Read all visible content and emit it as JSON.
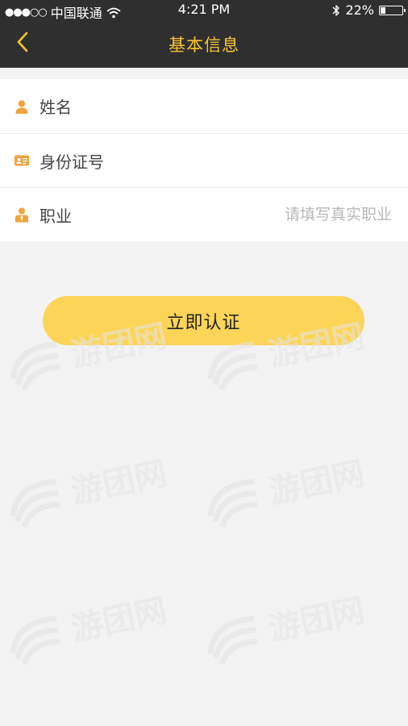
{
  "status_bar": {
    "signal": "●●●○○",
    "carrier": "中国联通",
    "time": "4:21 PM",
    "battery_text": "22%",
    "battery_level": 0.22
  },
  "nav": {
    "back_icon": "chevron-left-icon",
    "title": "基本信息",
    "accent_color": "#f7c431"
  },
  "form": {
    "rows": [
      {
        "icon": "person-icon",
        "label": "姓名",
        "placeholder": ""
      },
      {
        "icon": "id-card-icon",
        "label": "身份证号",
        "placeholder": ""
      },
      {
        "icon": "occupation-icon",
        "label": "职业",
        "placeholder": "请填写真实职业"
      }
    ]
  },
  "submit": {
    "label": "立即认证",
    "color": "#fcd458"
  },
  "watermark": {
    "text": "游团网"
  }
}
